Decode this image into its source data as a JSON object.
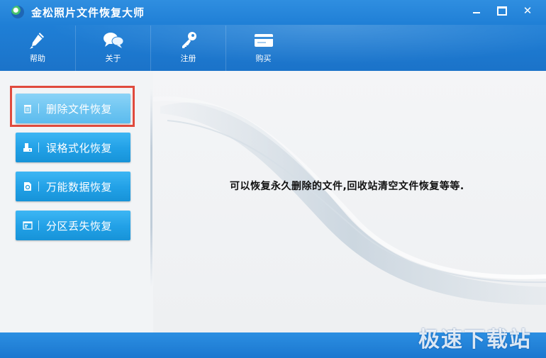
{
  "window": {
    "title": "金松照片文件恢复大师",
    "controls": [
      "minimize-icon",
      "maximize-icon",
      "close-icon"
    ]
  },
  "toolbar": {
    "items": [
      {
        "label": "帮助",
        "icon": "pen-icon"
      },
      {
        "label": "关于",
        "icon": "chat-bubbles-icon"
      },
      {
        "label": "注册",
        "icon": "key-icon"
      },
      {
        "label": "购买",
        "icon": "card-icon"
      }
    ]
  },
  "sidebar": {
    "items": [
      {
        "label": "删除文件恢复",
        "icon": "trash-icon",
        "active": true
      },
      {
        "label": "误格式化恢复",
        "icon": "drive-icon",
        "active": false
      },
      {
        "label": "万能数据恢复",
        "icon": "file-icon",
        "active": false
      },
      {
        "label": "分区丢失恢复",
        "icon": "partition-icon",
        "active": false
      }
    ]
  },
  "main": {
    "description": "可以恢复永久删除的文件,回收站清空文件恢复等等."
  },
  "watermark": "极速下载站",
  "colors": {
    "header": "#1f7fd6",
    "button": "#21a0e6",
    "button_active": "#6cc4f1",
    "highlight_border": "#e04a3d"
  }
}
